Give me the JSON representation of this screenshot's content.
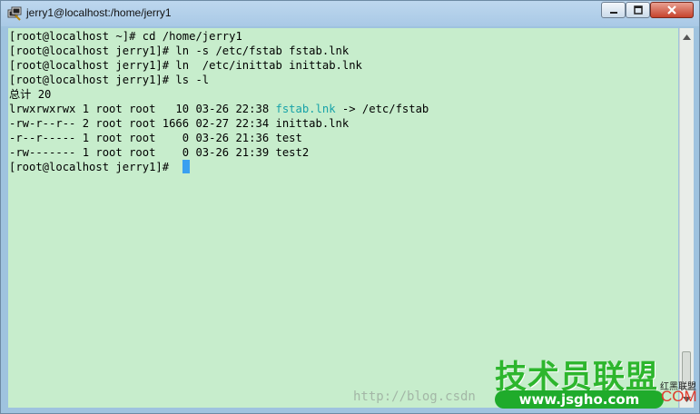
{
  "window": {
    "title": "jerry1@localhost:/home/jerry1"
  },
  "terminal": {
    "lines": [
      {
        "text": "[root@localhost ~]# cd /home/jerry1"
      },
      {
        "text": "[root@localhost jerry1]# ln -s /etc/fstab fstab.lnk"
      },
      {
        "text": "[root@localhost jerry1]# ln  /etc/inittab inittab.lnk"
      },
      {
        "text": "[root@localhost jerry1]# ls -l"
      },
      {
        "text": "总计 20"
      },
      {
        "pre": "lrwxrwxrwx 1 root root   10 03-26 22:38 ",
        "link": "fstab.lnk",
        "post": " -> /etc/fstab"
      },
      {
        "text": "-rw-r--r-- 2 root root 1666 02-27 22:34 inittab.lnk"
      },
      {
        "text": "-r--r----- 1 root root    0 03-26 21:36 test"
      },
      {
        "text": "-rw------- 1 root root    0 03-26 21:39 test2"
      }
    ],
    "prompt": "[root@localhost jerry1]# ",
    "link_color": "#17a2a8",
    "background": "#c7edcc",
    "cursor_color": "#3aa0f0"
  },
  "watermark": {
    "url": "http://blog.csdn",
    "logo_cn": "技术员联盟",
    "logo_url": "www.jsgho.com",
    "logo_com": "COM",
    "logo_small": "红黑联盟"
  }
}
